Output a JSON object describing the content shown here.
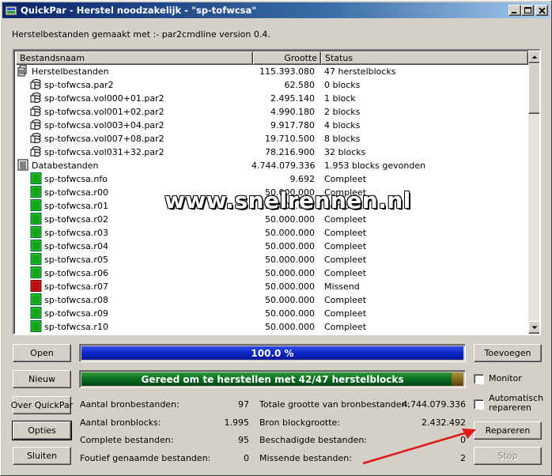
{
  "window": {
    "title": "QuickPar - Herstel noodzakelijk - \"sp-tofwcsa\"",
    "info_line": "Herstelbestanden gemaakt met :- par2cmdline version 0.4."
  },
  "list": {
    "columns": [
      "Bestandsnaam",
      "Grootte",
      "Status"
    ],
    "rows": [
      {
        "name": "Herstelbestanden",
        "size": "115.393.080",
        "status": "47 herstelblocks",
        "icon": "recovery-group-icon",
        "level": 0
      },
      {
        "name": "sp-tofwcsa.par2",
        "size": "62.580",
        "status": "0 blocks",
        "icon": "par2-file-icon",
        "level": 1
      },
      {
        "name": "sp-tofwcsa.vol000+01.par2",
        "size": "2.495.140",
        "status": "1 block",
        "icon": "par2-file-icon",
        "level": 1
      },
      {
        "name": "sp-tofwcsa.vol001+02.par2",
        "size": "4.990.180",
        "status": "2 blocks",
        "icon": "par2-file-icon",
        "level": 1
      },
      {
        "name": "sp-tofwcsa.vol003+04.par2",
        "size": "9.917.780",
        "status": "4 blocks",
        "icon": "par2-file-icon",
        "level": 1
      },
      {
        "name": "sp-tofwcsa.vol007+08.par2",
        "size": "19.710.500",
        "status": "8 blocks",
        "icon": "par2-file-icon",
        "level": 1
      },
      {
        "name": "sp-tofwcsa.vol031+32.par2",
        "size": "78.216.900",
        "status": "32 blocks",
        "icon": "par2-file-icon",
        "level": 1
      },
      {
        "name": "Databestanden",
        "size": "4.744.079.336",
        "status": "1.953 blocks gevonden",
        "icon": "data-group-icon",
        "level": 0
      },
      {
        "name": "sp-tofwcsa.nfo",
        "size": "9.692",
        "status": "Compleet",
        "icon": "complete-file-icon",
        "level": 1
      },
      {
        "name": "sp-tofwcsa.r00",
        "size": "50.000.000",
        "status": "Compleet",
        "icon": "complete-file-icon",
        "level": 1
      },
      {
        "name": "sp-tofwcsa.r01",
        "size": "50.000.000",
        "status": "Compleet",
        "icon": "complete-file-icon",
        "level": 1
      },
      {
        "name": "sp-tofwcsa.r02",
        "size": "50.000.000",
        "status": "Compleet",
        "icon": "complete-file-icon",
        "level": 1
      },
      {
        "name": "sp-tofwcsa.r03",
        "size": "50.000.000",
        "status": "Compleet",
        "icon": "complete-file-icon",
        "level": 1
      },
      {
        "name": "sp-tofwcsa.r04",
        "size": "50.000.000",
        "status": "Compleet",
        "icon": "complete-file-icon",
        "level": 1
      },
      {
        "name": "sp-tofwcsa.r05",
        "size": "50.000.000",
        "status": "Compleet",
        "icon": "complete-file-icon",
        "level": 1
      },
      {
        "name": "sp-tofwcsa.r06",
        "size": "50.000.000",
        "status": "Compleet",
        "icon": "complete-file-icon",
        "level": 1
      },
      {
        "name": "sp-tofwcsa.r07",
        "size": "50.000.000",
        "status": "Missend",
        "icon": "missing-file-icon",
        "level": 1
      },
      {
        "name": "sp-tofwcsa.r08",
        "size": "50.000.000",
        "status": "Compleet",
        "icon": "complete-file-icon",
        "level": 1
      },
      {
        "name": "sp-tofwcsa.r09",
        "size": "50.000.000",
        "status": "Compleet",
        "icon": "complete-file-icon",
        "level": 1
      },
      {
        "name": "sp-tofwcsa.r10",
        "size": "50.000.000",
        "status": "Compleet",
        "icon": "complete-file-icon",
        "level": 1
      }
    ]
  },
  "buttons": {
    "open": "Open",
    "new": "Nieuw",
    "about": "Over QuickPar",
    "options": "Opties",
    "close": "Sluiten",
    "add": "Toevoegen",
    "repair": "Repareren",
    "stop": "Stop"
  },
  "progress": {
    "verify_text": "100.0 %",
    "verify_fraction": 1.0,
    "status_text": "Gereed om te herstellen met 42/47 herstelblocks",
    "status_fraction": 0.97
  },
  "checkboxes": {
    "monitor": {
      "label": "Monitor",
      "checked": false
    },
    "auto_repair": {
      "label": "Automatisch\nrepareren",
      "checked": false
    }
  },
  "stats": {
    "source_files_label": "Aantal bronbestanden:",
    "source_files_value": "97",
    "source_blocks_label": "Aantal bronblocks:",
    "source_blocks_value": "1.995",
    "complete_files_label": "Complete bestanden:",
    "complete_files_value": "95",
    "misnamed_files_label": "Foutief genaamde bestanden:",
    "misnamed_files_value": "0",
    "total_size_label": "Totale grootte van bronbestanden:",
    "total_size_value": "4.744.079.336",
    "block_size_label": "Bron blockgrootte:",
    "block_size_value": "2.432.492",
    "damaged_files_label": "Beschadigde bestanden:",
    "damaged_files_value": "0",
    "missing_files_label": "Missende bestanden:",
    "missing_files_value": "2"
  },
  "watermark": "www.snelrennen.nl",
  "colors": {
    "progress_blue": "#0a24c8",
    "progress_green": "#0a6e1e",
    "progress_tail": "#8a6a20",
    "annotation_arrow": "#e01818"
  }
}
